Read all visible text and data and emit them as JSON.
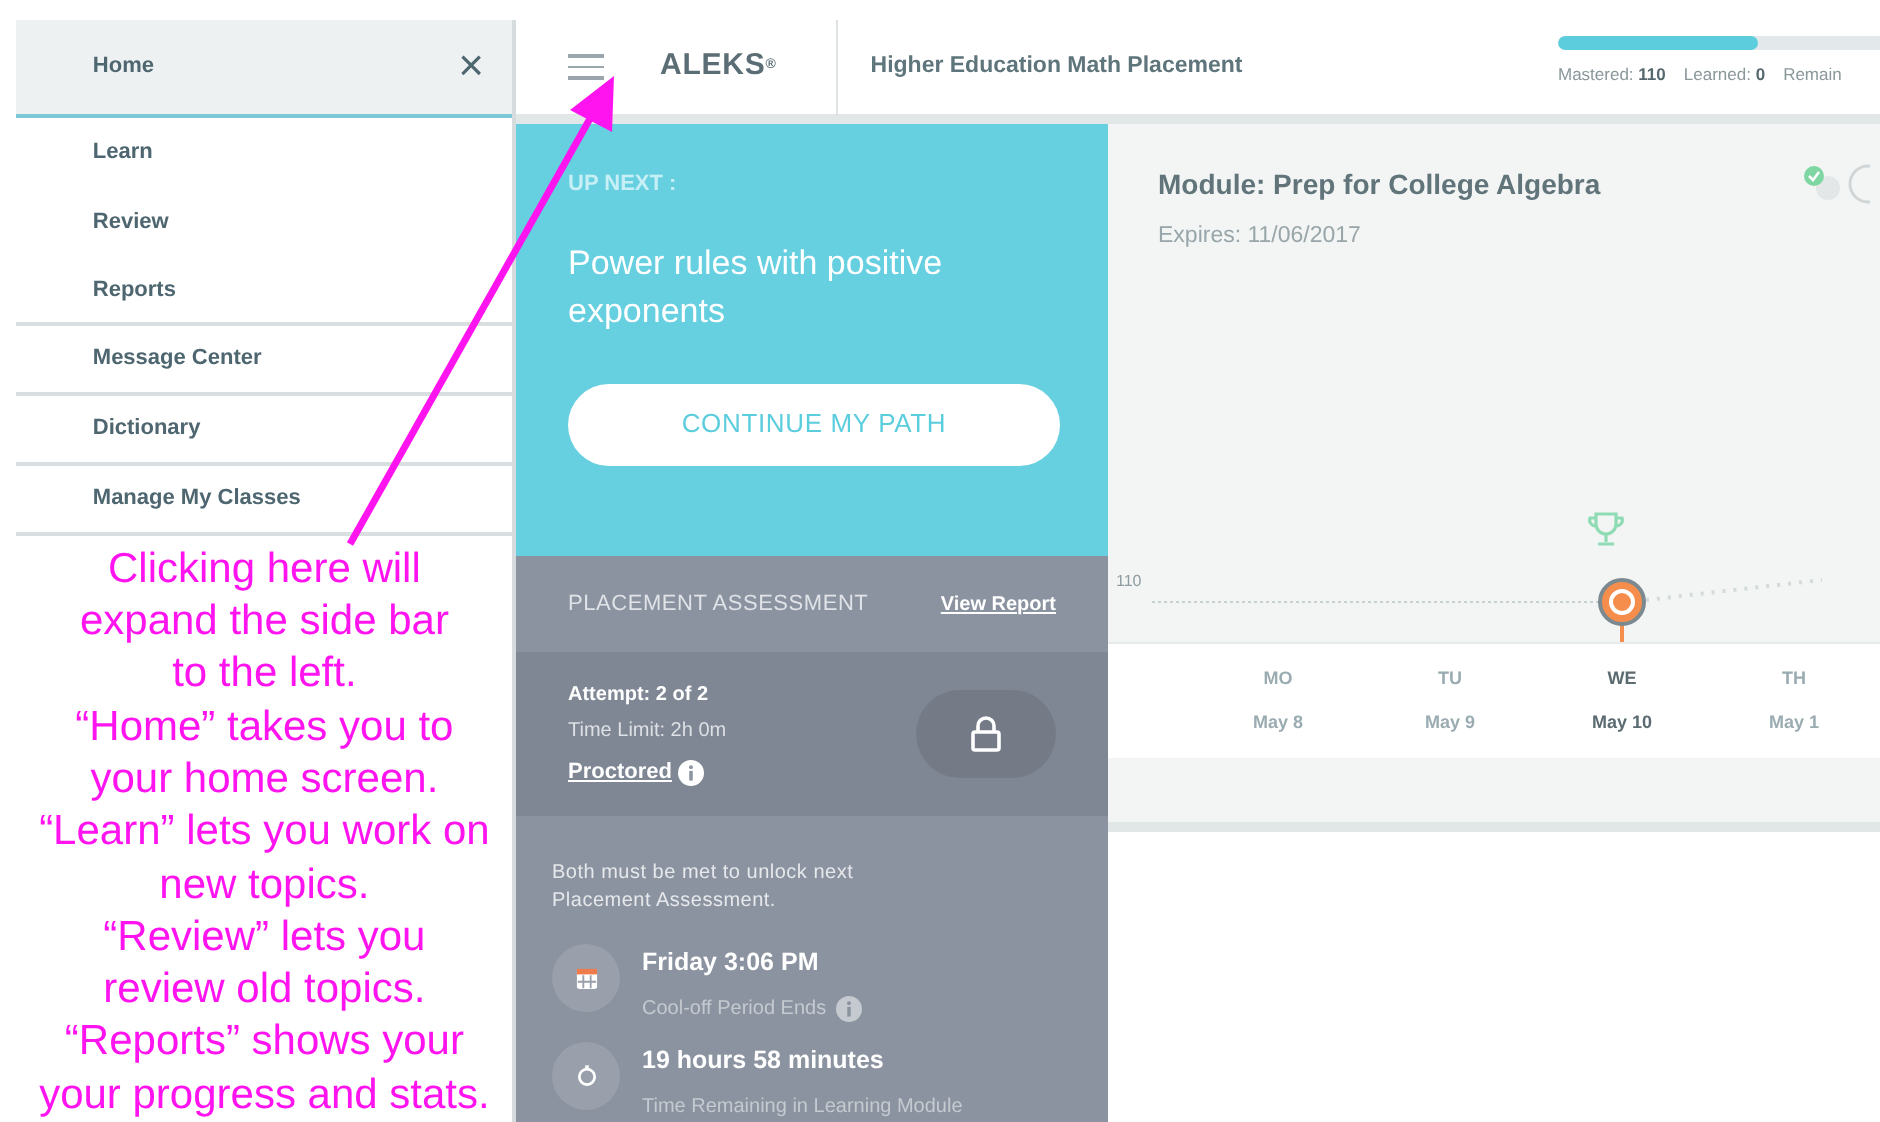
{
  "sidebar": {
    "close": "×",
    "items": [
      {
        "label": "Home",
        "selected": true
      },
      {
        "label": "Learn",
        "selected": false
      },
      {
        "label": "Review",
        "selected": false
      },
      {
        "label": "Reports",
        "selected": false
      },
      {
        "label": "Message Center",
        "selected": false
      },
      {
        "label": "Dictionary",
        "selected": false
      },
      {
        "label": "Manage My Classes",
        "selected": false
      }
    ]
  },
  "annotation": {
    "lines": [
      "Clicking here will",
      "expand the side bar",
      "to the left.",
      "“Home” takes you to",
      "your home screen.",
      "“Learn” lets you work on",
      "new topics.",
      "“Review” lets you",
      "review old topics.",
      "“Reports” shows your",
      "your progress and stats."
    ]
  },
  "header": {
    "logo": "ALEKS",
    "logo_mark": "®",
    "course": "Higher Education Math Placement",
    "progress": {
      "level": 0.62,
      "stats": [
        {
          "label": "Mastered:",
          "value": "110"
        },
        {
          "label": "Learned:",
          "value": "0"
        },
        {
          "label": "Remain"
        }
      ]
    }
  },
  "up_next": {
    "heading": "UP NEXT :",
    "topic": "Power rules with positive exponents",
    "button": "CONTINUE MY PATH"
  },
  "placement": {
    "heading": "PLACEMENT ASSESSMENT",
    "link": "View Report",
    "attempt": "Attempt: 2 of 2",
    "time_limit": "Time Limit: 2h 0m",
    "proctored": "Proctored",
    "locked": true,
    "note": "Both must be met to unlock next Placement Assessment.",
    "conditions": [
      {
        "kind": "calendar",
        "title": "Friday 3:06 PM",
        "subtitle": "Cool-off Period Ends",
        "info": true
      },
      {
        "kind": "timer",
        "title": "19 hours 58 minutes",
        "subtitle": "Time Remaining in Learning Module",
        "info": false
      }
    ]
  },
  "module": {
    "title": "Module: Prep for College Algebra",
    "expires": "Expires: 11/06/2017",
    "axis_label": "110",
    "days": [
      {
        "day": "MO",
        "date": "May 8",
        "selected": false
      },
      {
        "day": "TU",
        "date": "May 9",
        "selected": false
      },
      {
        "day": "WE",
        "date": "May 10",
        "selected": true
      },
      {
        "day": "TH",
        "date": "May 1",
        "selected": false
      }
    ]
  }
}
